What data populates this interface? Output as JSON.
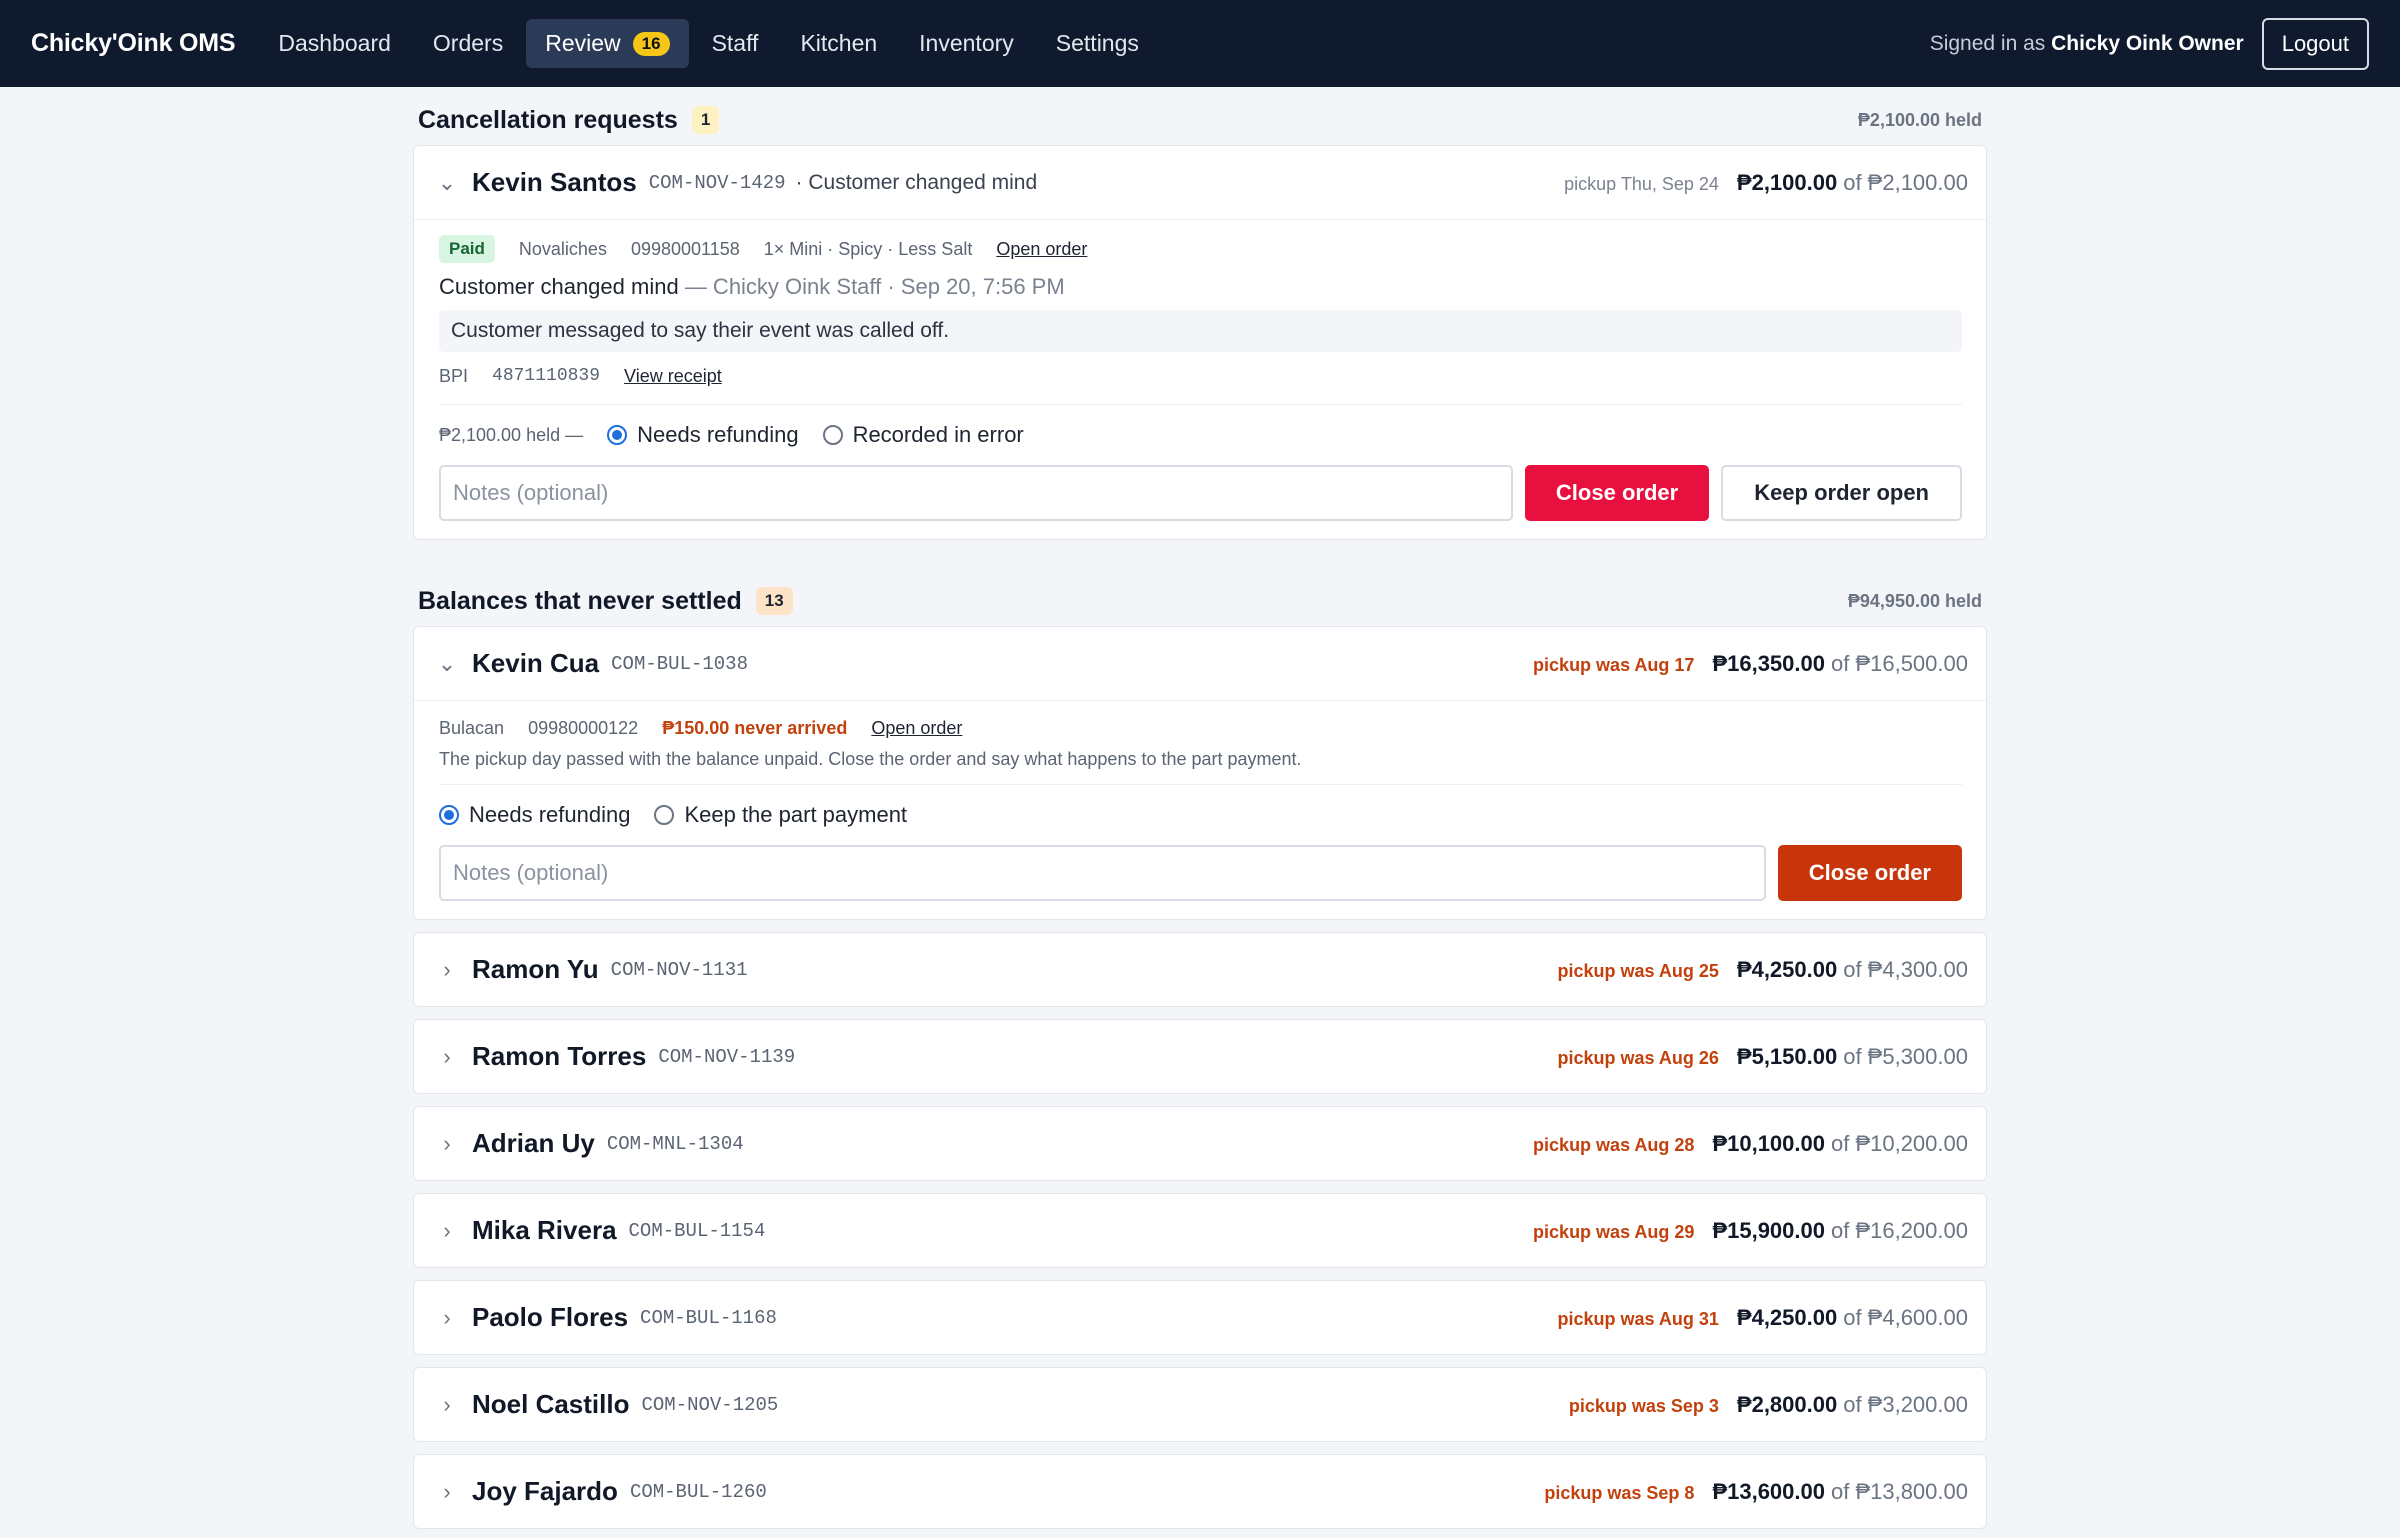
{
  "nav": {
    "brand": "Chicky'Oink OMS",
    "links": [
      {
        "label": "Dashboard"
      },
      {
        "label": "Orders"
      },
      {
        "label": "Review",
        "badge": "16"
      },
      {
        "label": "Staff"
      },
      {
        "label": "Kitchen"
      },
      {
        "label": "Inventory"
      },
      {
        "label": "Settings"
      }
    ],
    "signed_prefix": "Signed in as",
    "signed_user": "Chicky Oink Owner",
    "logout": "Logout"
  },
  "cancellations": {
    "title": "Cancellation requests",
    "count": "1",
    "held": "₱2,100.00 held",
    "card": {
      "name": "Kevin Santos",
      "code": "COM-NOV-1429",
      "reason_inline": "· Customer changed mind",
      "pickup": "pickup Thu, Sep 24",
      "amount": "₱2,100.00",
      "of": "of ₱2,100.00",
      "status": "Paid",
      "branch": "Novaliches",
      "phone": "09980001158",
      "items": "1× Mini · Spicy · Less Salt",
      "open_order": "Open order",
      "reason": "Customer changed mind",
      "reason_meta": "— Chicky Oink Staff · Sep 20, 7:56 PM",
      "message": "Customer messaged to say their event was called off.",
      "bank": "BPI",
      "ref": "4871110839",
      "receipt": "View receipt",
      "held_label": "₱2,100.00 held —",
      "opt1": "Needs refunding",
      "opt2": "Recorded in error",
      "notes_placeholder": "Notes (optional)",
      "close": "Close order",
      "keep": "Keep order open"
    }
  },
  "balances": {
    "title": "Balances that never settled",
    "count": "13",
    "held": "₱94,950.00 held",
    "open_card": {
      "name": "Kevin Cua",
      "code": "COM-BUL-1038",
      "pickup": "pickup was Aug 17",
      "amount": "₱16,350.00",
      "of": "of ₱16,500.00",
      "branch": "Bulacan",
      "phone": "09980000122",
      "never": "₱150.00 never arrived",
      "open_order": "Open order",
      "explain": "The pickup day passed with the balance unpaid. Close the order and say what happens to the part payment.",
      "opt1": "Needs refunding",
      "opt2": "Keep the part payment",
      "notes_placeholder": "Notes (optional)",
      "close": "Close order"
    },
    "rows": [
      {
        "name": "Ramon Yu",
        "code": "COM-NOV-1131",
        "pickup": "pickup was Aug 25",
        "amount": "₱4,250.00",
        "of": "of ₱4,300.00"
      },
      {
        "name": "Ramon Torres",
        "code": "COM-NOV-1139",
        "pickup": "pickup was Aug 26",
        "amount": "₱5,150.00",
        "of": "of ₱5,300.00"
      },
      {
        "name": "Adrian Uy",
        "code": "COM-MNL-1304",
        "pickup": "pickup was Aug 28",
        "amount": "₱10,100.00",
        "of": "of ₱10,200.00"
      },
      {
        "name": "Mika Rivera",
        "code": "COM-BUL-1154",
        "pickup": "pickup was Aug 29",
        "amount": "₱15,900.00",
        "of": "of ₱16,200.00"
      },
      {
        "name": "Paolo Flores",
        "code": "COM-BUL-1168",
        "pickup": "pickup was Aug 31",
        "amount": "₱4,250.00",
        "of": "of ₱4,600.00"
      },
      {
        "name": "Noel Castillo",
        "code": "COM-NOV-1205",
        "pickup": "pickup was Sep 3",
        "amount": "₱2,800.00",
        "of": "of ₱3,200.00"
      },
      {
        "name": "Joy Fajardo",
        "code": "COM-BUL-1260",
        "pickup": "pickup was Sep 8",
        "amount": "₱13,600.00",
        "of": "of ₱13,800.00"
      }
    ]
  },
  "colors": {
    "nav_bg": "#0f1a2e",
    "close_red": "#e8103f",
    "close_orange": "#c9350b",
    "late_text": "#c2410c",
    "radio_blue": "#1d6fe0"
  }
}
